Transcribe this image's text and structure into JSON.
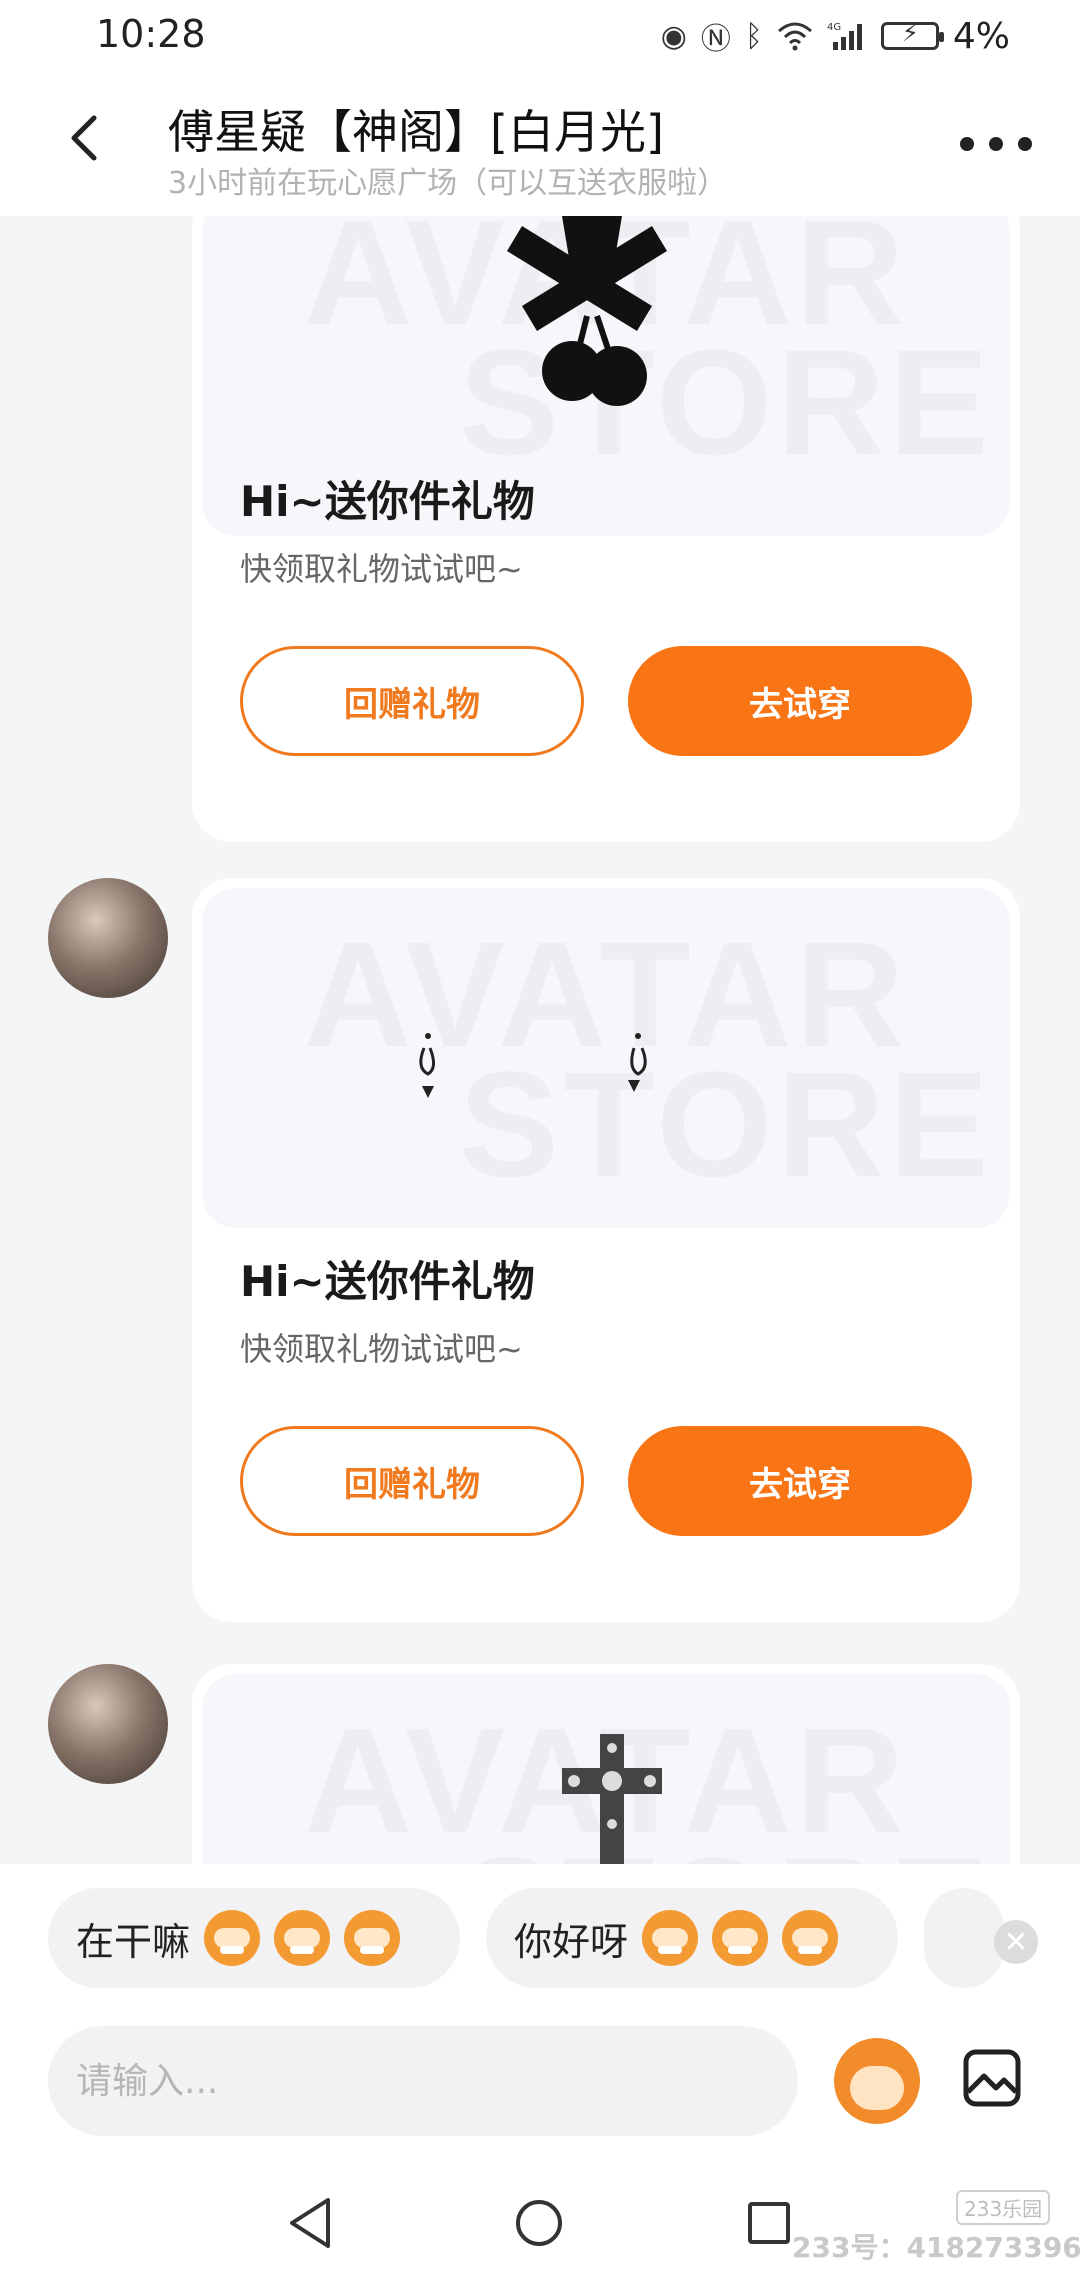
{
  "status_bar": {
    "time": "10:28",
    "battery_percent": "4%",
    "network": "4G"
  },
  "header": {
    "title": "傅星疑【神阁】[白月光]",
    "subtitle": "3小时前在玩心愿广场（可以互送衣服啦）"
  },
  "messages": [
    {
      "title": "Hi~送你件礼物",
      "subtitle": "快领取礼物试试吧~",
      "return_button": "回赠礼物",
      "try_button": "去试穿",
      "watermark": [
        "AVATAR",
        "STORE"
      ],
      "item": "cherry-hair-clip"
    },
    {
      "title": "Hi~送你件礼物",
      "subtitle": "快领取礼物试试吧~",
      "return_button": "回赠礼物",
      "try_button": "去试穿",
      "watermark": [
        "AVATAR",
        "STORE"
      ],
      "item": "earrings"
    },
    {
      "watermark": [
        "AVATAR",
        "STORE"
      ],
      "item": "cross-pendant"
    }
  ],
  "quick_replies": [
    {
      "text": "在干嘛",
      "emoji_count": 3
    },
    {
      "text": "你好呀",
      "emoji_count": 3
    }
  ],
  "input": {
    "placeholder": "请输入..."
  },
  "watermark": {
    "logo": "233乐园",
    "text": "233号：418273396"
  },
  "colors": {
    "accent": "#f87414",
    "outline": "#f07a1d",
    "background": "#f4f5f7"
  }
}
